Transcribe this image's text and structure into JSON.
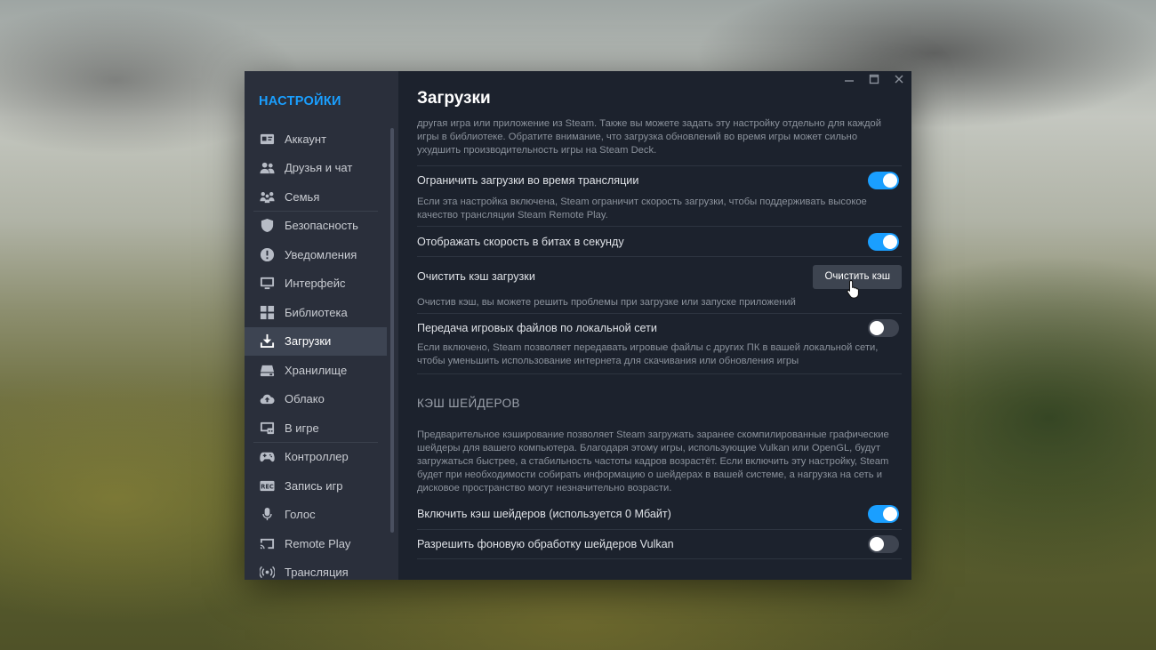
{
  "window": {
    "title": "Загрузки",
    "controls": {
      "minimize": "minimize",
      "maximize": "maximize",
      "close": "close"
    }
  },
  "sidebar": {
    "title": "НАСТРОЙКИ",
    "items": [
      {
        "label": "Аккаунт",
        "icon": "account-card-icon"
      },
      {
        "label": "Друзья и чат",
        "icon": "friends-icon"
      },
      {
        "label": "Семья",
        "icon": "family-icon"
      },
      {
        "label": "Безопасность",
        "icon": "shield-icon"
      },
      {
        "label": "Уведомления",
        "icon": "notification-icon"
      },
      {
        "label": "Интерфейс",
        "icon": "monitor-icon"
      },
      {
        "label": "Библиотека",
        "icon": "grid-icon"
      },
      {
        "label": "Загрузки",
        "icon": "download-icon",
        "active": true
      },
      {
        "label": "Хранилище",
        "icon": "drive-icon"
      },
      {
        "label": "Облако",
        "icon": "cloud-icon"
      },
      {
        "label": "В игре",
        "icon": "in-game-icon"
      },
      {
        "label": "Контроллер",
        "icon": "gamepad-icon"
      },
      {
        "label": "Запись игр",
        "icon": "rec-icon"
      },
      {
        "label": "Голос",
        "icon": "microphone-icon"
      },
      {
        "label": "Remote Play",
        "icon": "cast-icon"
      },
      {
        "label": "Трансляция",
        "icon": "broadcast-icon"
      }
    ]
  },
  "main": {
    "intro_text": "другая игра или приложение из Steam. Также вы можете задать эту настройку отдельно для каждой игры в библиотеке. Обратите внимание, что загрузка обновлений во время игры может сильно ухудшить производительность игры на Steam Deck.",
    "limit_broadcast": {
      "label": "Ограничить загрузки во время трансляции",
      "enabled": true,
      "description": "Если эта настройка включена, Steam ограничит скорость загрузки, чтобы поддерживать высокое качество трансляции Steam Remote Play."
    },
    "bits_speed": {
      "label": "Отображать скорость в битах в секунду",
      "enabled": true
    },
    "clear_cache": {
      "label": "Очистить кэш загрузки",
      "button": "Очистить кэш",
      "description": "Очистив кэш, вы можете решить проблемы при загрузке или запуске приложений"
    },
    "lan_transfer": {
      "label": "Передача игровых файлов по локальной сети",
      "enabled": false,
      "description": "Если включено, Steam позволяет передавать игровые файлы с других ПК в вашей локальной сети, чтобы уменьшить использование интернета для скачивания или обновления игры"
    },
    "shader_section": {
      "header": "КЭШ ШЕЙДЕРОВ",
      "description": "Предварительное кэширование позволяет Steam загружать заранее скомпилированные графические шейдеры для вашего компьютера. Благодаря этому игры, использующие Vulkan или OpenGL, будут загружаться быстрее, а стабильность частоты кадров возрастёт. Если включить эту настройку, Steam будет при необходимости собирать информацию о шейдерах в вашей системе, а нагрузка на сеть и дисковое пространство могут незначительно возрасти."
    },
    "shader_cache": {
      "label": "Включить кэш шейдеров (используется 0 Мбайт)",
      "enabled": true
    },
    "vulkan_bg": {
      "label": "Разрешить фоновую обработку шейдеров Vulkan",
      "enabled": false
    }
  },
  "colors": {
    "accent": "#1a9fff",
    "window_bg": "#1c222d",
    "sidebar_bg": "#2a2f3b",
    "active_item_bg": "#3d4452"
  }
}
